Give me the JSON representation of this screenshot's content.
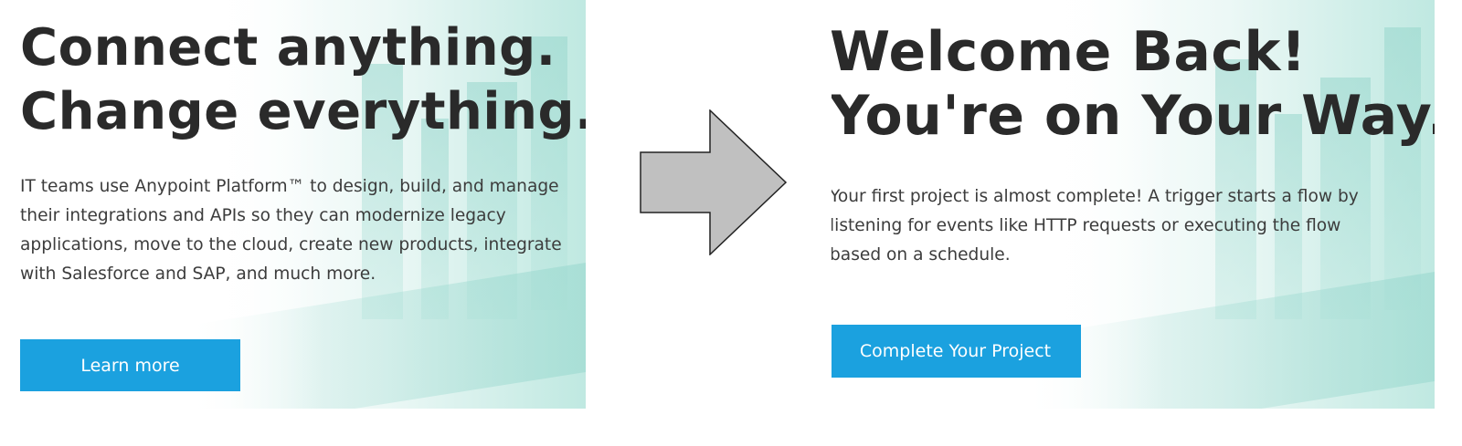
{
  "before": {
    "headline_line1": "Connect anything.",
    "headline_line2": "Change everything.",
    "body": "IT teams use Anypoint Platform™ to design, build, and manage their integrations and APIs so they can modernize legacy applications, move to the cloud, create new products, integrate with Salesforce and SAP, and much more.",
    "button_label": "Learn more"
  },
  "after": {
    "headline_line1": "Welcome Back!",
    "headline_line2": "You're on Your Way...",
    "body": "Your first project is almost complete! A trigger starts a flow by listening for events like HTTP requests or executing the flow based on a schedule.",
    "button_label": "Complete Your Project"
  },
  "colors": {
    "button": "#1ba1df",
    "heading": "#2a2a2a",
    "arrow_fill": "#c0c0c0",
    "background_tint": "#aee1d7"
  },
  "icons": {
    "transition": "right-arrow-icon"
  }
}
